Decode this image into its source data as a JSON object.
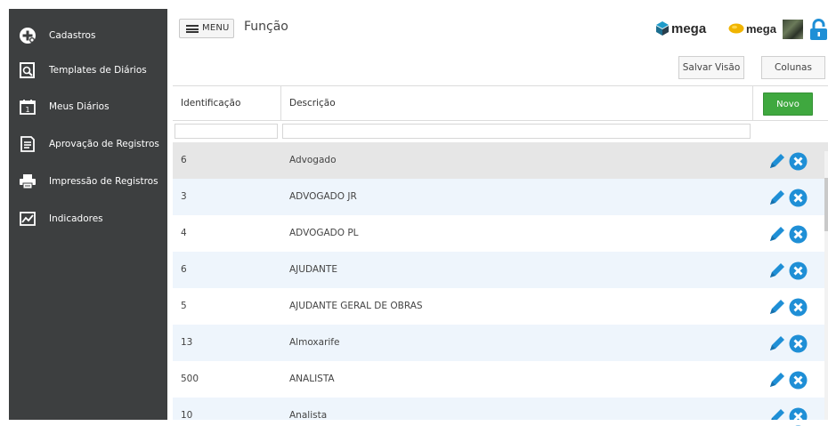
{
  "sidebar": {
    "items": [
      {
        "label": "Cadastros",
        "icon": "plus-circle-icon"
      },
      {
        "label": "Templates de Diários",
        "icon": "document-search-icon"
      },
      {
        "label": "Meus Diários",
        "icon": "calendar-icon"
      },
      {
        "label": "Aprovação de Registros",
        "icon": "checklist-icon"
      },
      {
        "label": "Impressão de Registros",
        "icon": "printer-icon"
      },
      {
        "label": "Indicadores",
        "icon": "chart-icon"
      }
    ]
  },
  "header": {
    "menu_label": "MENU",
    "title": "Função",
    "logo1_text": "mega",
    "logo2_text": "mega"
  },
  "toolbar": {
    "save_view_label": "Salvar Visão",
    "columns_label": "Colunas"
  },
  "table": {
    "columns": [
      "Identificação",
      "Descrição"
    ],
    "new_label": "Novo",
    "filters": {
      "id": "",
      "desc": ""
    },
    "rows": [
      {
        "id": "6",
        "desc": "Advogado"
      },
      {
        "id": "3",
        "desc": "ADVOGADO JR"
      },
      {
        "id": "4",
        "desc": "ADVOGADO PL"
      },
      {
        "id": "6",
        "desc": "AJUDANTE"
      },
      {
        "id": "5",
        "desc": "AJUDANTE GERAL DE OBRAS"
      },
      {
        "id": "13",
        "desc": "Almoxarife"
      },
      {
        "id": "500",
        "desc": "ANALISTA"
      },
      {
        "id": "10",
        "desc": "Analista"
      }
    ]
  },
  "colors": {
    "sidebar_bg": "#3d3f40",
    "accent_blue": "#1f8fd6",
    "novo_green": "#3fa83f",
    "row_alt": "#eef5fc",
    "row_hover": "#e6e6e6"
  }
}
